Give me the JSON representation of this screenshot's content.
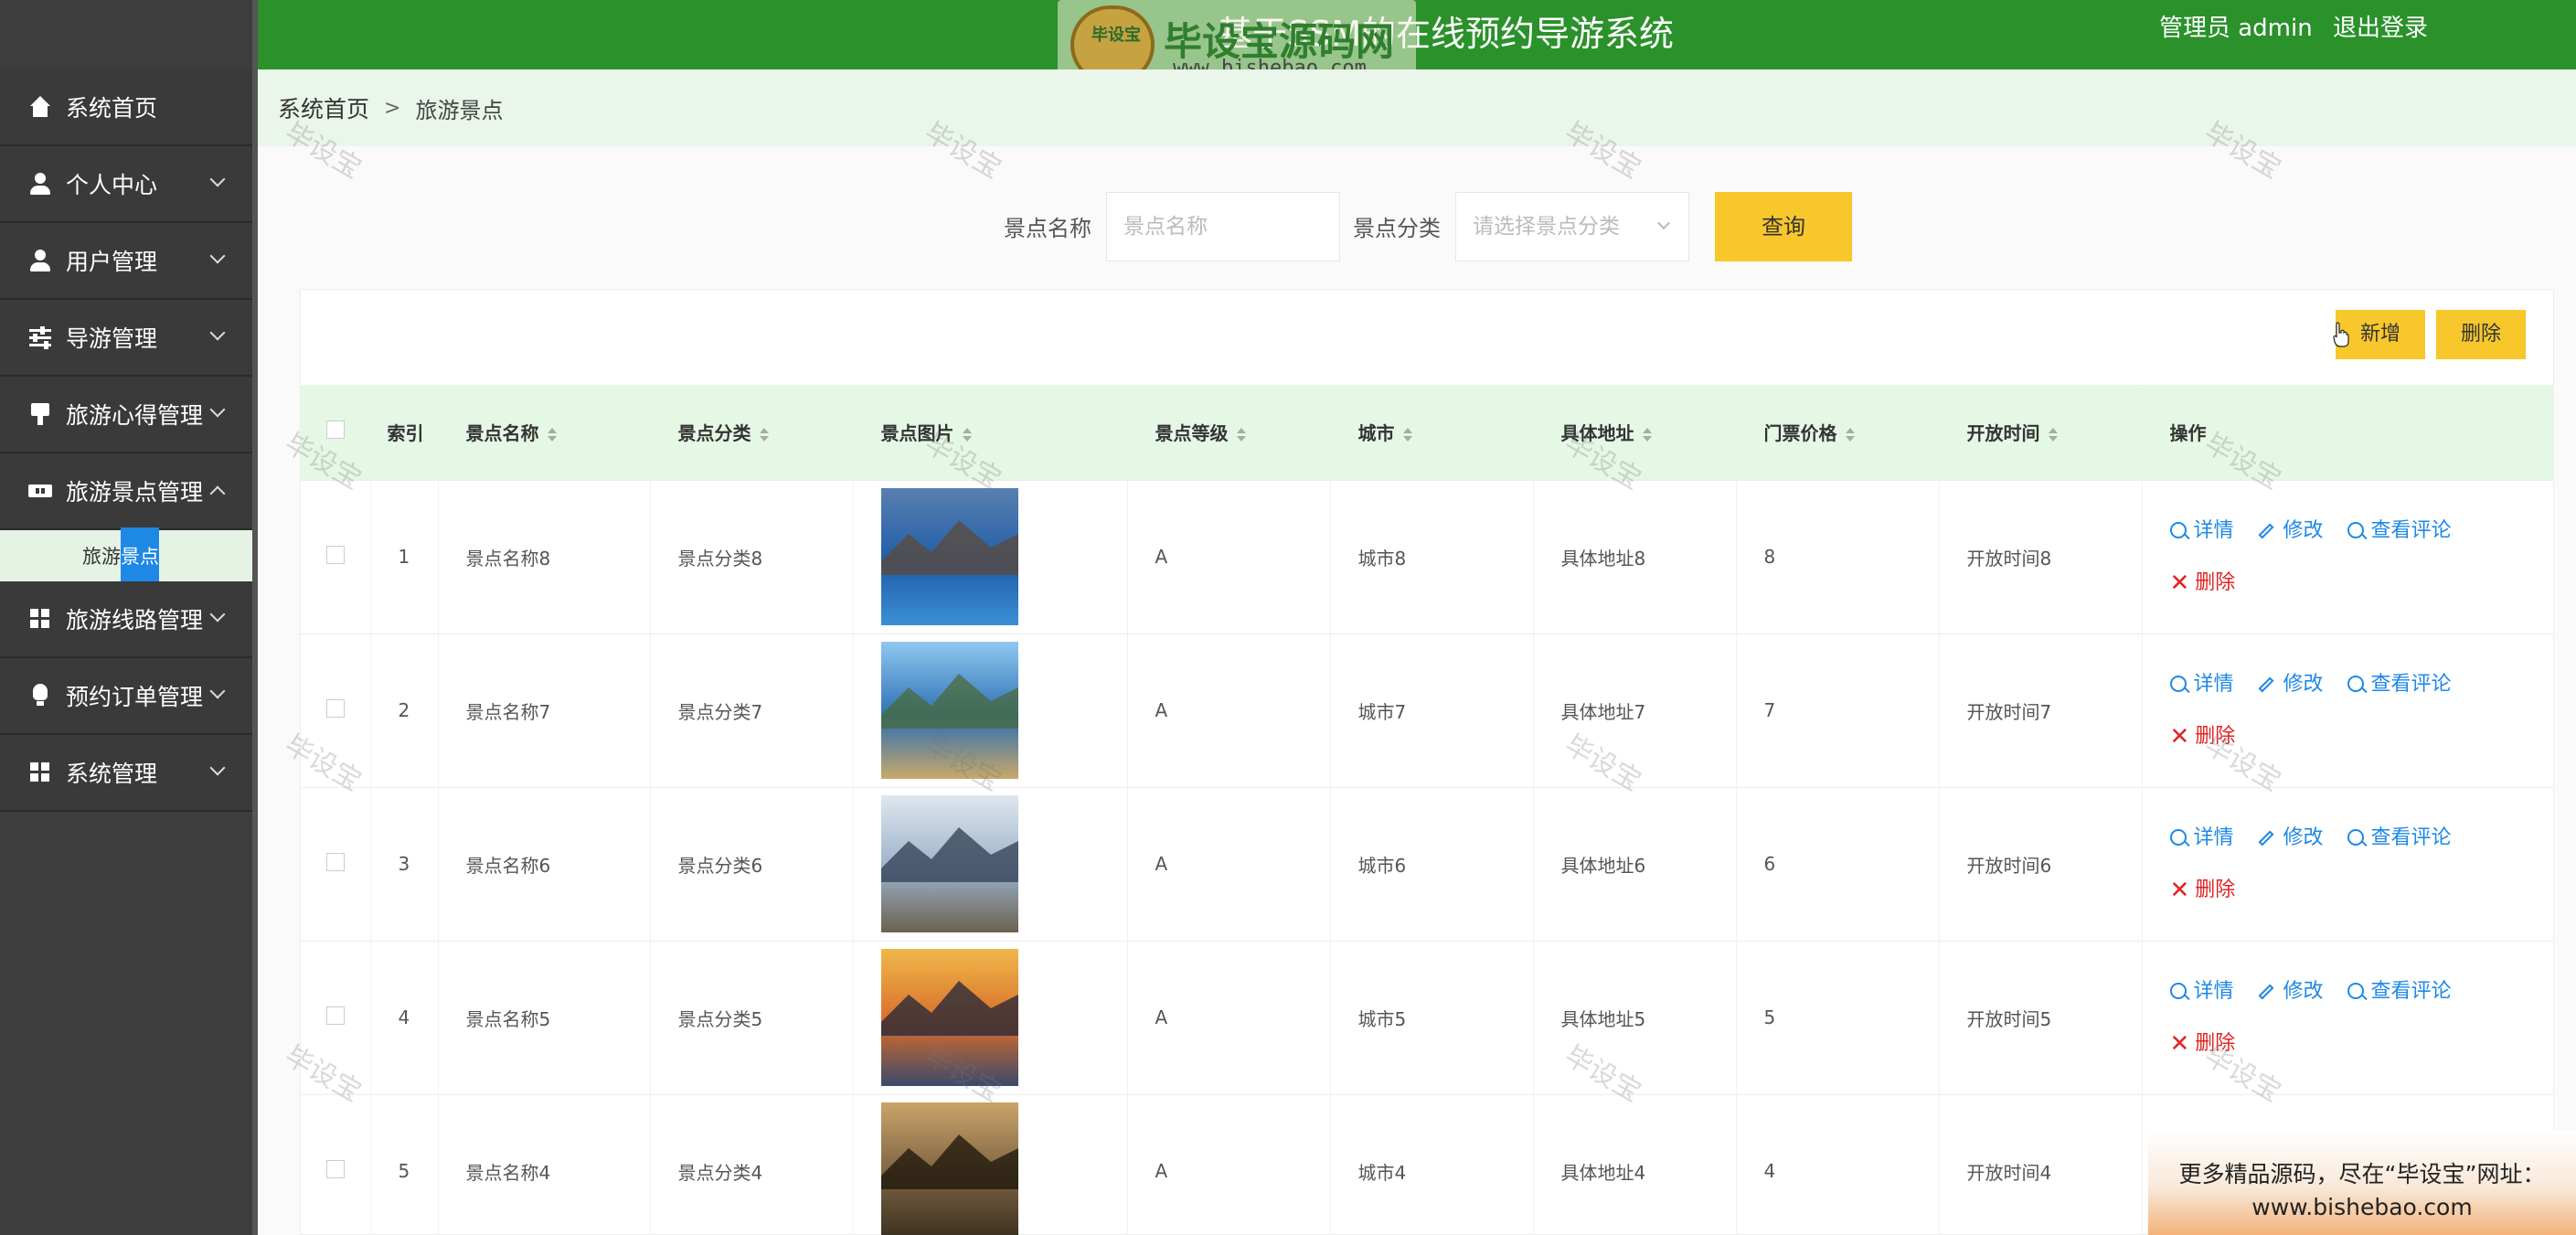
{
  "header": {
    "title": "基于SSM的在线预约导游系统",
    "user_label": "管理员 admin",
    "logout": "退出登录"
  },
  "watermark": {
    "seal": "毕设宝",
    "brand": "毕设宝源码网",
    "url": "www.bishebao.com",
    "tag": "毕设宝"
  },
  "sidebar": {
    "items": [
      {
        "label": "系统首页",
        "icon": "home-icon"
      },
      {
        "label": "个人中心",
        "icon": "user-icon"
      },
      {
        "label": "用户管理",
        "icon": "user-icon"
      },
      {
        "label": "导游管理",
        "icon": "sliders-icon"
      },
      {
        "label": "旅游心得管理",
        "icon": "stamp-icon"
      },
      {
        "label": "旅游景点管理",
        "icon": "ticket-icon"
      },
      {
        "label": "旅游线路管理",
        "icon": "grid-icon"
      },
      {
        "label": "预约订单管理",
        "icon": "bulb-icon"
      },
      {
        "label": "系统管理",
        "icon": "grid-icon"
      }
    ],
    "submenu": {
      "prefix": "旅游",
      "highlight": "景点"
    }
  },
  "breadcrumb": {
    "home": "系统首页",
    "sep": ">",
    "current": "旅游景点"
  },
  "search": {
    "name_label": "景点名称",
    "name_placeholder": "景点名称",
    "category_label": "景点分类",
    "category_placeholder": "请选择景点分类",
    "query_button": "查询"
  },
  "toolbar": {
    "add": "新增",
    "delete": "删除"
  },
  "table": {
    "headers": [
      "索引",
      "景点名称",
      "景点分类",
      "景点图片",
      "景点等级",
      "城市",
      "具体地址",
      "门票价格",
      "开放时间",
      "操作"
    ],
    "rows": [
      {
        "index": "1",
        "name": "景点名称8",
        "category": "景点分类8",
        "level": "A",
        "city": "城市8",
        "address": "具体地址8",
        "price": "8",
        "open": "开放时间8"
      },
      {
        "index": "2",
        "name": "景点名称7",
        "category": "景点分类7",
        "level": "A",
        "city": "城市7",
        "address": "具体地址7",
        "price": "7",
        "open": "开放时间7"
      },
      {
        "index": "3",
        "name": "景点名称6",
        "category": "景点分类6",
        "level": "A",
        "city": "城市6",
        "address": "具体地址6",
        "price": "6",
        "open": "开放时间6"
      },
      {
        "index": "4",
        "name": "景点名称5",
        "category": "景点分类5",
        "level": "A",
        "city": "城市5",
        "address": "具体地址5",
        "price": "5",
        "open": "开放时间5"
      },
      {
        "index": "5",
        "name": "景点名称4",
        "category": "景点分类4",
        "level": "A",
        "city": "城市4",
        "address": "具体地址4",
        "price": "4",
        "open": "开放时间4"
      }
    ],
    "actions": {
      "detail": "详情",
      "edit": "修改",
      "review": "查看评论",
      "delete": "删除"
    }
  },
  "promo": {
    "line1": "更多精品源码，尽在“毕设宝”网址：",
    "line2": "www.bishebao.com"
  },
  "colors": {
    "header_green": "#2b912b",
    "sidebar": "#3d3d3d",
    "accent_yellow": "#f7c72c",
    "link_blue": "#1e88e5",
    "danger_red": "#e02424",
    "table_head_bg": "#e5f8e5"
  }
}
